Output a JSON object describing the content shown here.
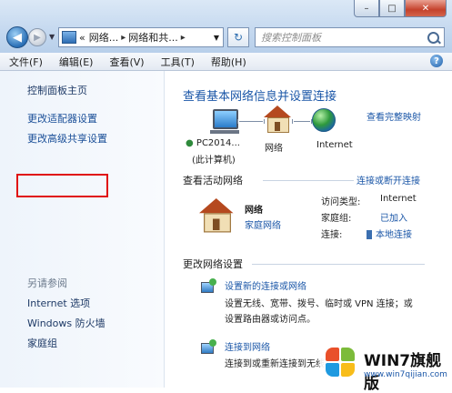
{
  "window": {
    "minimize": "–",
    "maximize": "□",
    "close": "✕"
  },
  "nav": {
    "address_parts": [
      "网络...",
      "网络和共..."
    ],
    "address_prefix": "«",
    "search_placeholder": "搜索控制面板"
  },
  "menu": [
    "文件(F)",
    "编辑(E)",
    "查看(V)",
    "工具(T)",
    "帮助(H)"
  ],
  "sidebar": {
    "items": [
      "控制面板主页",
      "更改适配器设置",
      "更改高级共享设置"
    ],
    "see_also_title": "另请参阅",
    "see_also": [
      "Internet 选项",
      "Windows 防火墙",
      "家庭组"
    ]
  },
  "main": {
    "title": "查看基本网络信息并设置连接",
    "full_map_link": "查看完整映射",
    "map": {
      "pc_name": "PC2014...",
      "pc_sub": "(此计算机)",
      "network": "网络",
      "internet": "Internet"
    },
    "active_section": "查看活动网络",
    "connect_link": "连接或断开连接",
    "network_name": "网络",
    "network_type": "家庭网络",
    "access_type_label": "访问类型:",
    "access_type_value": "Internet",
    "homegroup_label": "家庭组:",
    "homegroup_value": "已加入",
    "connection_label": "连接:",
    "connection_value": "本地连接",
    "change_section": "更改网络设置",
    "actions": [
      {
        "title": "设置新的连接或网络",
        "desc1": "设置无线、宽带、拨号、临时或 VPN 连接；或",
        "desc2": "设置路由器或访问点。"
      },
      {
        "title": "连接到网络",
        "desc1": "连接到或重新连接到无线..."
      }
    ]
  },
  "watermark": {
    "brand": "WIN7旗舰版",
    "url": "www.win7qijian.com"
  }
}
